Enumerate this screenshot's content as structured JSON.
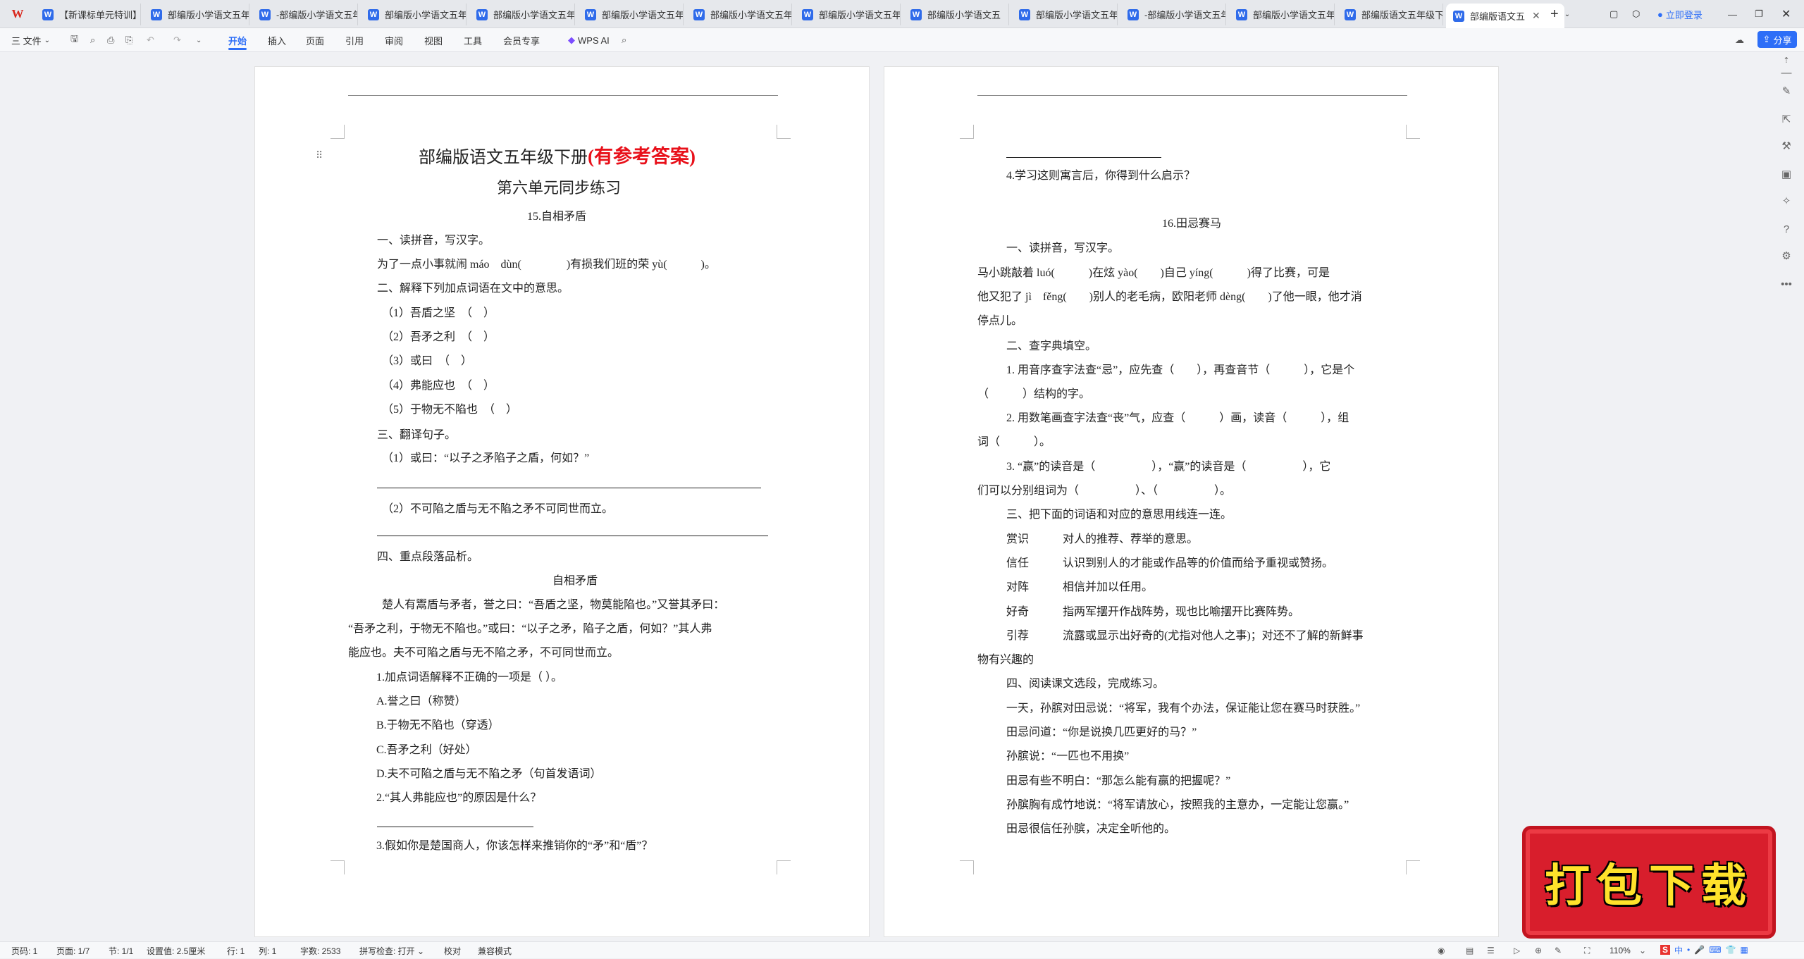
{
  "tabbar": {
    "tabs": [
      {
        "label": "【新课标单元特训】"
      },
      {
        "label": "部编版小学语文五年"
      },
      {
        "label": "-部编版小学语文五年"
      },
      {
        "label": "部编版小学语文五年"
      },
      {
        "label": "部编版小学语文五年"
      },
      {
        "label": "部编版小学语文五年"
      },
      {
        "label": "部编版小学语文五年"
      },
      {
        "label": "部编版小学语文五年"
      },
      {
        "label": "部编版小学语文五"
      },
      {
        "label": "部编版小学语文五年"
      },
      {
        "label": "-部编版小学语文五年"
      },
      {
        "label": "部编版小学语文五年"
      },
      {
        "label": "部编版语文五年级下"
      },
      {
        "label": "部编版语文五"
      }
    ],
    "login": "立即登录",
    "new_tab": "+"
  },
  "toolbar": {
    "file": "三 文件",
    "menus": [
      "开始",
      "插入",
      "页面",
      "引用",
      "审阅",
      "视图",
      "工具",
      "会员专享"
    ],
    "wps_ai": "WPS AI",
    "share": "分享"
  },
  "left_page": {
    "title_main": "部编版语文五年级下册",
    "title_red": "(有参考答案)",
    "subtitle": "第六单元同步练习",
    "lesson": "15.自相矛盾",
    "lines": [
      "一、读拼音，写汉字。",
      "为了一点小事就闹 máo　dùn(　　　　)有损我们班的荣 yù(　　　)。",
      "二、解释下列加点词语在文中的意思。",
      "（1）吾盾之坚　（　）",
      "（2）吾矛之利　（　）",
      "（3）或曰　（　）",
      "（4）弗能应也　（　）",
      "（5）于物无不陷也　（　）",
      "三、翻译句子。",
      "（1）或曰：“以子之矛陷子之盾，何如？”",
      "（2）不可陷之盾与无不陷之矛不可同世而立。",
      "四、重点段落品析。",
      "自相矛盾",
      "楚人有鬻盾与矛者，誉之曰：“吾盾之坚，物莫能陷也。”又誉其矛曰：",
      "“吾矛之利，于物无不陷也。”或曰：“以子之矛，陷子之盾，何如？”其人弗",
      "能应也。夫不可陷之盾与无不陷之矛，不可同世而立。",
      "1.加点词语解释不正确的一项是（ ）。",
      "A.誉之曰（称赞）",
      "B.于物无不陷也（穿透）",
      "C.吾矛之利（好处）",
      "D.夫不可陷之盾与无不陷之矛（句首发语词）",
      "2.“其人弗能应也”的原因是什么？",
      "3.假如你是楚国商人，你该怎样来推销你的“矛”和“盾”？"
    ]
  },
  "right_page": {
    "lines": [
      "4.学习这则寓言后，你得到什么启示？",
      "16.田忌赛马",
      "一、读拼音，写汉字。",
      "马小跳敲着 luó(　　　)在炫 yào(　　)自己 yíng(　　　)得了比赛，可是",
      "他又犯了 jì　fěng(　　)别人的老毛病，欧阳老师 dèng(　　)了他一眼，他才消",
      "停点儿。",
      "二、查字典填空。",
      "1. 用音序查字法查“忌”，应先查（　　），再查音节（　　　），它是个",
      "（　　　）结构的字。",
      "2. 用数笔画查字法查“丧”气，应查（　　　）画，读音（　　　），组",
      "词（　　　）。",
      "3. “赢”的读音是（　　　　　），“赢”的读音是（　　　　　），它",
      "们可以分别组词为（　　　　　）、（　　　　　）。",
      "三、把下面的词语和对应的意思用线连一连。",
      "赏识　　　对人的推荐、荐举的意思。",
      "信任　　　认识到别人的才能或作品等的价值而给予重视或赞扬。",
      "对阵　　　相信并加以任用。",
      "好奇　　　指两军摆开作战阵势，现也比喻摆开比赛阵势。",
      "引荐　　　流露或显示出好奇的(尤指对他人之事)；对还不了解的新鲜事",
      "物有兴趣的",
      "四、阅读课文选段，完成练习。",
      "一天，孙膑对田忌说：“将军，我有个办法，保证能让您在赛马时获胜。”",
      "田忌问道：“你是说换几匹更好的马？”",
      "孙膑说：“一匹也不用换”",
      "田忌有些不明白：“那怎么能有赢的把握呢？”",
      "孙膑胸有成竹地说：“将军请放心，按照我的主意办，一定能让您赢。”",
      "田忌很信任孙膑，决定全听他的。"
    ]
  },
  "statusbar": {
    "items": [
      "页码: 1",
      "页面: 1/7",
      "节: 1/1",
      "设置值: 2.5厘米",
      "行: 1",
      "列: 1",
      "字数: 2533",
      "拼写检查: 打开 ⌄",
      "校对",
      "兼容模式"
    ],
    "zoom": "110%"
  },
  "overlay": {
    "download": "打包下载",
    "ime": "中"
  }
}
